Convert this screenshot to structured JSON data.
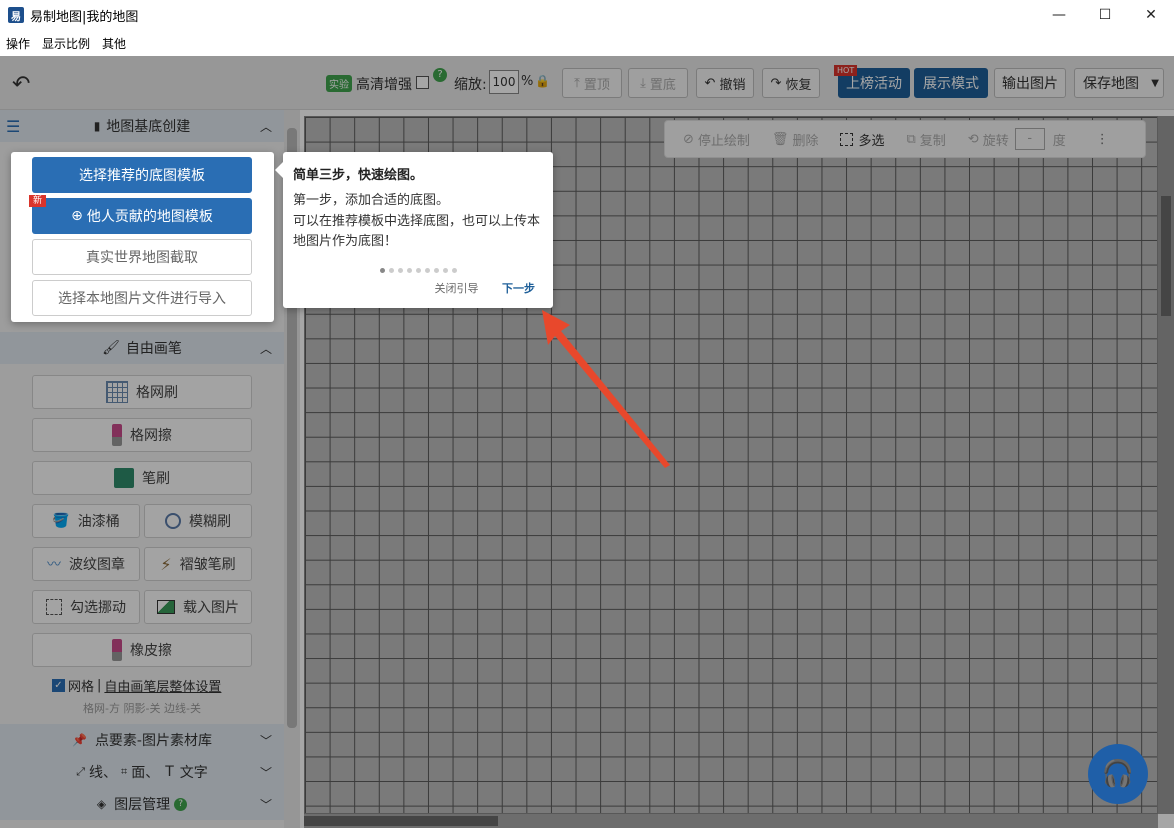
{
  "window": {
    "title": "易制地图|我的地图",
    "app_icon": "易",
    "minimize": "—",
    "maximize": "☐",
    "close": "✕"
  },
  "menu": [
    "操作",
    "显示比例",
    "其他"
  ],
  "toolbar": {
    "undo_icon": "↶",
    "experiment_badge": "实验",
    "hd_label": "高清增强",
    "help": "?",
    "zoom_label": "缩放:",
    "zoom_value": "100",
    "zoom_unit": "%",
    "to_top": "置顶",
    "to_bottom": "置底",
    "undo": "撤销",
    "redo": "恢复",
    "hot_badge": "HOT",
    "ranking": "上榜活动",
    "display_mode": "展示模式",
    "export_image": "输出图片",
    "save_map": "保存地图"
  },
  "sidebar": {
    "sec_base": "地图基底创建",
    "sec_brush": "自由画笔",
    "brush_buttons": {
      "grid_brush": "格网刷",
      "grid_erase": "格网擦",
      "pen": "笔刷",
      "paint_bucket": "油漆桶",
      "blur_brush": "模糊刷",
      "wave_stamp": "波纹图章",
      "wrinkle_brush": "褶皱笔刷",
      "select_move": "勾选挪动",
      "load_image": "载入图片",
      "eraser": "橡皮擦"
    },
    "grid_check_label": "网格",
    "grid_sep": "|",
    "layer_settings_link": "自由画笔层整体设置",
    "grid_status": "格网-方 阴影-关 边线-关",
    "sec_points": "点要素-图片素材库",
    "sec_lines_a": "线、",
    "sec_lines_b": "面、",
    "sec_lines_c": "文字",
    "sec_layers": "图层管理"
  },
  "float_bar": {
    "stop_draw": "停止绘制",
    "delete": "删除",
    "multi_select": "多选",
    "copy": "复制",
    "rotate": "旋转",
    "rotate_value": "-",
    "degree": "度"
  },
  "base_popup": {
    "recommended": "选择推荐的底图模板",
    "new_badge": "新",
    "contributed": "他人贡献的地图模板",
    "real_world": "真实世界地图截取",
    "import_local": "选择本地图片文件进行导入"
  },
  "guide": {
    "title": "简单三步，快速绘图。",
    "line1": "第一步，添加合适的底图。",
    "line2": "可以在推荐模板中选择底图，也可以上传本地图片作为底图！",
    "close": "关闭引导",
    "next": "下一步",
    "current_step": 1,
    "total_steps": 9
  },
  "colors": {
    "accent": "#1e5f99",
    "arrow": "#e8482c"
  }
}
